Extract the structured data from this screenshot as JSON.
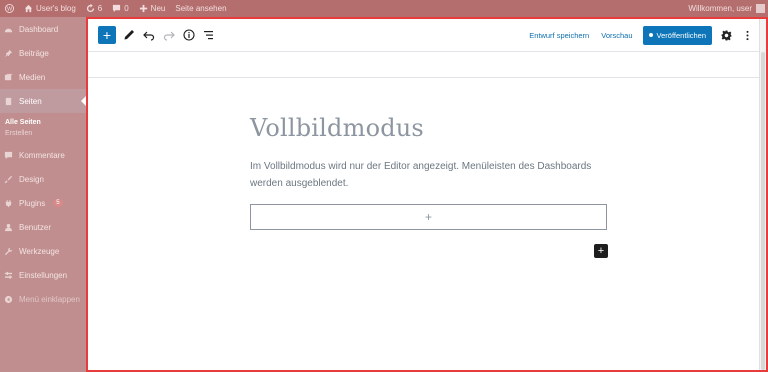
{
  "adminbar": {
    "site_name": "User's blog",
    "updates_count": "6",
    "comments_count": "0",
    "new_label": "Neu",
    "view_page_label": "Seite ansehen",
    "greeting": "Willkommen, user"
  },
  "sidebar": {
    "items": [
      {
        "label": "Dashboard",
        "icon": "dashboard-icon"
      },
      {
        "label": "Beiträge",
        "icon": "pin-icon"
      },
      {
        "label": "Medien",
        "icon": "media-icon"
      },
      {
        "label": "Seiten",
        "icon": "pages-icon"
      },
      {
        "label": "Kommentare",
        "icon": "comments-icon"
      },
      {
        "label": "Design",
        "icon": "brush-icon"
      },
      {
        "label": "Plugins",
        "icon": "plugin-icon",
        "badge": "5"
      },
      {
        "label": "Benutzer",
        "icon": "users-icon"
      },
      {
        "label": "Werkzeuge",
        "icon": "tools-icon"
      },
      {
        "label": "Einstellungen",
        "icon": "settings-icon"
      },
      {
        "label": "Menü einklappen",
        "icon": "collapse-icon"
      }
    ],
    "submenu": {
      "all_pages": "Alle Seiten",
      "create": "Erstellen"
    }
  },
  "editor": {
    "toolbar": {
      "add_label": "+",
      "save_draft": "Entwurf speichern",
      "preview": "Vorschau",
      "publish": "Veröffentlichen"
    },
    "content": {
      "title": "Vollbildmodus",
      "paragraph": "Im Vollbildmodus wird nur der Editor angezeigt. Menüleisten des Dashboards werden ausgeblendet.",
      "appender": "+",
      "inserter": "+"
    },
    "accent_color": "#0e75b8",
    "highlight_border": "#e83b3b"
  }
}
